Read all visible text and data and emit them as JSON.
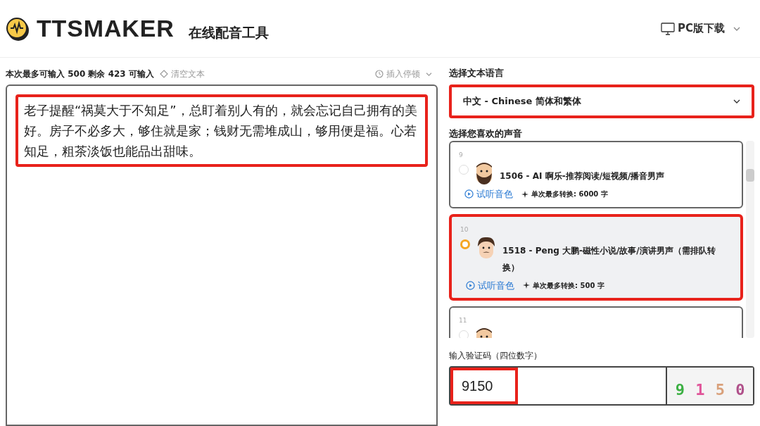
{
  "header": {
    "logo": "TTSMAKER",
    "subtitle": "在线配音工具",
    "download": "PC版下载"
  },
  "editor": {
    "limit_label": "本次最多可输入",
    "limit": "500",
    "remaining_label": "剩余",
    "remaining": "423",
    "remaining_suffix": "可输入",
    "clear": "清空文本",
    "pause": "插入停顿",
    "text": "老子提醒“祸莫大于不知足”，总盯着别人有的，就会忘记自己拥有的美好。房子不必多大，够住就是家；钱财无需堆成山，够用便是福。心若知足，粗茶淡饭也能品出甜味。",
    "highlighted": true
  },
  "language": {
    "label": "选择文本语言",
    "value": "中文 - Chinese 简体和繁体",
    "highlighted": true
  },
  "voices": {
    "label": "选择您喜欢的声音",
    "items": [
      {
        "index": "9",
        "name": "1506 - AI 啊乐-推荐阅读/短视频/播音男声",
        "preview": "试听音色",
        "limit": "单次最多转换: 6000 字",
        "selected": false,
        "kind": "beard"
      },
      {
        "index": "10",
        "name": "1518 - Peng 大鹏-磁性小说/故事/演讲男声（需排队转换）",
        "preview": "试听音色",
        "limit": "单次最多转换: 500 字",
        "selected": true,
        "kind": "mustache"
      },
      {
        "index": "11",
        "selected": false,
        "kind": "beard"
      }
    ]
  },
  "captcha": {
    "label": "输入验证码（四位数字）",
    "value": "9150",
    "highlighted": true,
    "image_digits": [
      {
        "text": "9",
        "color": "#3cb043"
      },
      {
        "text": "1",
        "color": "#e0559a"
      },
      {
        "text": "5",
        "color": "#d9a07a"
      },
      {
        "text": "0",
        "color": "#b0508a"
      }
    ]
  }
}
